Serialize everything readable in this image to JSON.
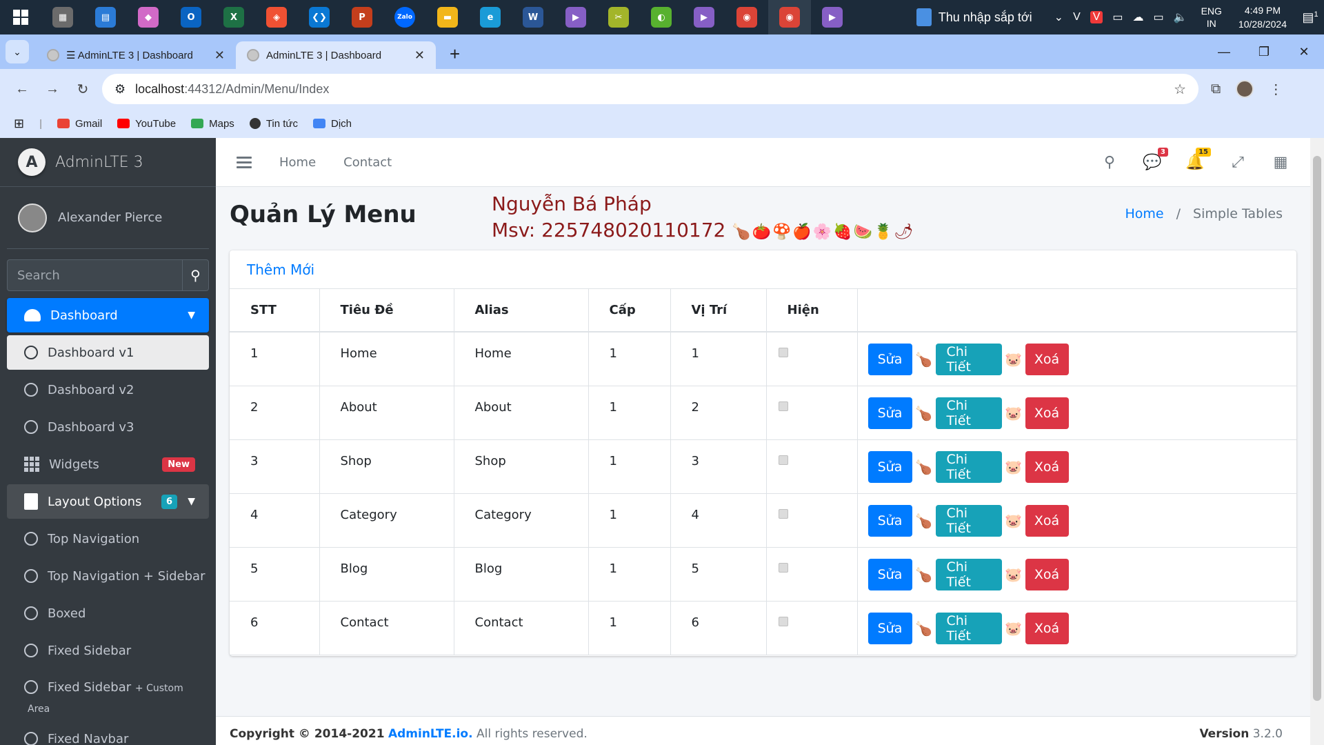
{
  "taskbar": {
    "apps": [
      {
        "name": "photos-app-icon",
        "color": "#6b6b6b",
        "glyph": "▦"
      },
      {
        "name": "store-app-icon",
        "color": "#2b7bd6",
        "glyph": "▤"
      },
      {
        "name": "copilot-app-icon",
        "color": "#d16ac7",
        "glyph": "◆"
      },
      {
        "name": "outlook-app-icon",
        "color": "#0a64c2",
        "glyph": "O"
      },
      {
        "name": "excel-app-icon",
        "color": "#1e7145",
        "glyph": "X"
      },
      {
        "name": "git-app-icon",
        "color": "#f05133",
        "glyph": "◈"
      },
      {
        "name": "vscode-app-icon",
        "color": "#0a78d4",
        "glyph": "❮❯"
      },
      {
        "name": "powerpoint-app-icon",
        "color": "#c43e1c",
        "glyph": "P"
      },
      {
        "name": "zalo-app-icon",
        "color": "#0068ff",
        "glyph": "Zalo"
      },
      {
        "name": "explorer-app-icon",
        "color": "#f2b61a",
        "glyph": "▬"
      },
      {
        "name": "edge-app-icon",
        "color": "#1a9bd7",
        "glyph": "e"
      },
      {
        "name": "word-app-icon",
        "color": "#2b5797",
        "glyph": "W"
      },
      {
        "name": "visualstudio-app-icon",
        "color": "#865fc5",
        "glyph": "▶"
      },
      {
        "name": "snipping-app-icon",
        "color": "#a3b52a",
        "glyph": "✂"
      },
      {
        "name": "app-green-icon",
        "color": "#58b12f",
        "glyph": "◐"
      },
      {
        "name": "visualstudio-pre-app-icon",
        "color": "#865fc5",
        "glyph": "▶"
      },
      {
        "name": "chrome-app-icon",
        "color": "#db4437",
        "glyph": "◉"
      },
      {
        "name": "chrome-profile-app-icon",
        "color": "#db4437",
        "glyph": "◉"
      },
      {
        "name": "visualstudio-pre2-app-icon",
        "color": "#865fc5",
        "glyph": "▶"
      }
    ],
    "weather_text": "Thu nhập sắp tới",
    "lang_top": "ENG",
    "lang_bottom": "IN",
    "time": "4:49 PM",
    "date": "10/28/2024",
    "notif_count": "1"
  },
  "browser": {
    "tabs": [
      {
        "title": "☰ AdminLTE 3 | Dashboard",
        "active": false
      },
      {
        "title": "AdminLTE 3 | Dashboard",
        "active": true
      }
    ],
    "url_host": "localhost",
    "url_path": ":44312/Admin/Menu/Index",
    "bookmarks": [
      {
        "label": "Gmail",
        "color": "#ea4335"
      },
      {
        "label": "YouTube",
        "color": "#ff0000"
      },
      {
        "label": "Maps",
        "color": "#34a853"
      },
      {
        "label": "Tin tức",
        "color": "#333333"
      },
      {
        "label": "Dịch",
        "color": "#4285f4"
      }
    ]
  },
  "sidebar": {
    "brand": "AdminLTE 3",
    "brand_logo": "A",
    "user": "Alexander Pierce",
    "search_placeholder": "Search",
    "items": [
      {
        "label": "Dashboard"
      },
      {
        "label": "Dashboard v1"
      },
      {
        "label": "Dashboard v2"
      },
      {
        "label": "Dashboard v3"
      },
      {
        "label": "Widgets",
        "badge": "New"
      },
      {
        "label": "Layout Options",
        "badge": "6"
      },
      {
        "label": "Top Navigation"
      },
      {
        "label": "Top Navigation + Sidebar"
      },
      {
        "label": "Boxed"
      },
      {
        "label": "Fixed Sidebar"
      },
      {
        "label": "Fixed Sidebar",
        "suffix": "+ Custom",
        "extra": "Area"
      },
      {
        "label": "Fixed Navbar"
      }
    ]
  },
  "navbar": {
    "links": [
      "Home",
      "Contact"
    ],
    "messages_count": "3",
    "notifications_count": "15"
  },
  "content": {
    "title": "Quản Lý Menu",
    "author_line1": "Nguyễn Bá Pháp",
    "author_line2": "Msv: 225748020110172",
    "author_emoji": "🍗🍅🍄🍎🌸🍓🍉🍍🌶",
    "breadcrumb_home": "Home",
    "breadcrumb_current": "Simple Tables",
    "add_new": "Thêm Mới",
    "columns": [
      "STT",
      "Tiêu Đề",
      "Alias",
      "Cấp",
      "Vị Trí",
      "Hiện",
      ""
    ],
    "rows": [
      {
        "stt": "1",
        "title": "Home",
        "alias": "Home",
        "level": "1",
        "position": "1",
        "visible": true
      },
      {
        "stt": "2",
        "title": "About",
        "alias": "About",
        "level": "1",
        "position": "2",
        "visible": true
      },
      {
        "stt": "3",
        "title": "Shop",
        "alias": "Shop",
        "level": "1",
        "position": "3",
        "visible": true
      },
      {
        "stt": "4",
        "title": "Category",
        "alias": "Category",
        "level": "1",
        "position": "4",
        "visible": true
      },
      {
        "stt": "5",
        "title": "Blog",
        "alias": "Blog",
        "level": "1",
        "position": "5",
        "visible": true
      },
      {
        "stt": "6",
        "title": "Contact",
        "alias": "Contact",
        "level": "1",
        "position": "6",
        "visible": true
      }
    ],
    "btn_edit": "Sửa",
    "btn_detail": "Chi Tiết",
    "btn_delete": "Xoá",
    "deco1": "🍗",
    "deco2": "🐷"
  },
  "footer": {
    "copyright": "Copyright © 2014-2021",
    "brand_link": "AdminLTE.io.",
    "rights": "All rights reserved.",
    "version_label": "Version",
    "version": "3.2.0"
  },
  "colors": {
    "primary": "#007bff",
    "info": "#17a2b8",
    "danger": "#dc3545",
    "sidebar_bg": "#343a40",
    "author_text": "#8b1a1a"
  }
}
